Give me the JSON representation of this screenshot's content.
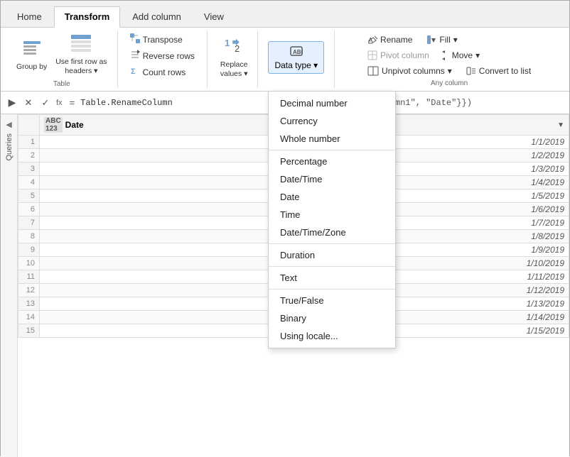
{
  "tabs": [
    {
      "id": "home",
      "label": "Home"
    },
    {
      "id": "transform",
      "label": "Transform",
      "active": true
    },
    {
      "id": "add-column",
      "label": "Add column"
    },
    {
      "id": "view",
      "label": "View"
    }
  ],
  "ribbon": {
    "groups": [
      {
        "id": "table",
        "label": "Table",
        "buttons": [
          {
            "id": "group-by",
            "label": "Group\nby",
            "type": "large"
          },
          {
            "id": "use-first-row",
            "label": "Use first row as\nheaders",
            "type": "large-split"
          }
        ]
      },
      {
        "id": "any-column-transform",
        "label": "",
        "buttons": [
          {
            "id": "transpose",
            "label": "Transpose",
            "type": "small"
          },
          {
            "id": "reverse-rows",
            "label": "Reverse rows",
            "type": "small"
          },
          {
            "id": "count-rows",
            "label": "Count rows",
            "type": "small"
          }
        ]
      },
      {
        "id": "replace",
        "label": "",
        "buttons": [
          {
            "id": "replace-values",
            "label": "Replace\nvalues",
            "type": "medium"
          }
        ]
      },
      {
        "id": "data-type",
        "label": "Data type",
        "dropdown": true
      }
    ],
    "rename_label": "Rename",
    "fill_label": "Fill",
    "pivot_label": "Pivot column",
    "move_label": "Move",
    "unpivot_label": "Unpivot columns",
    "convert_label": "Convert to list",
    "any_column_label": "Any column"
  },
  "formula_bar": {
    "content": "= Table.RenameColumn",
    "full_content": "= Table.RenameColumns(#\"Changed Type\", {{\"Column1\", \"Date\"}})"
  },
  "table": {
    "columns": [
      {
        "id": "date",
        "name": "Date",
        "type": "ABC\n123"
      }
    ],
    "rows": [
      {
        "num": 1,
        "date": "1/1/2019"
      },
      {
        "num": 2,
        "date": "1/2/2019"
      },
      {
        "num": 3,
        "date": "1/3/2019"
      },
      {
        "num": 4,
        "date": "1/4/2019"
      },
      {
        "num": 5,
        "date": "1/5/2019"
      },
      {
        "num": 6,
        "date": "1/6/2019"
      },
      {
        "num": 7,
        "date": "1/7/2019"
      },
      {
        "num": 8,
        "date": "1/8/2019"
      },
      {
        "num": 9,
        "date": "1/9/2019"
      },
      {
        "num": 10,
        "date": "1/10/2019"
      },
      {
        "num": 11,
        "date": "1/11/2019"
      },
      {
        "num": 12,
        "date": "1/12/2019"
      },
      {
        "num": 13,
        "date": "1/13/2019"
      },
      {
        "num": 14,
        "date": "1/14/2019"
      },
      {
        "num": 15,
        "date": "1/15/2019"
      }
    ]
  },
  "dropdown": {
    "items": [
      {
        "id": "decimal",
        "label": "Decimal number",
        "separator": false
      },
      {
        "id": "currency",
        "label": "Currency",
        "separator": false
      },
      {
        "id": "whole",
        "label": "Whole number",
        "separator": false
      },
      {
        "id": "percentage",
        "label": "Percentage",
        "separator": true
      },
      {
        "id": "datetime",
        "label": "Date/Time",
        "separator": false
      },
      {
        "id": "date",
        "label": "Date",
        "separator": false
      },
      {
        "id": "time",
        "label": "Time",
        "separator": false
      },
      {
        "id": "datetimezone",
        "label": "Date/Time/Zone",
        "separator": false
      },
      {
        "id": "duration",
        "label": "Duration",
        "separator": true
      },
      {
        "id": "text",
        "label": "Text",
        "separator": true
      },
      {
        "id": "truefalse",
        "label": "True/False",
        "separator": true
      },
      {
        "id": "binary",
        "label": "Binary",
        "separator": false
      },
      {
        "id": "using-locale",
        "label": "Using locale...",
        "separator": false
      }
    ]
  },
  "sidebar": {
    "label": "Queries"
  }
}
